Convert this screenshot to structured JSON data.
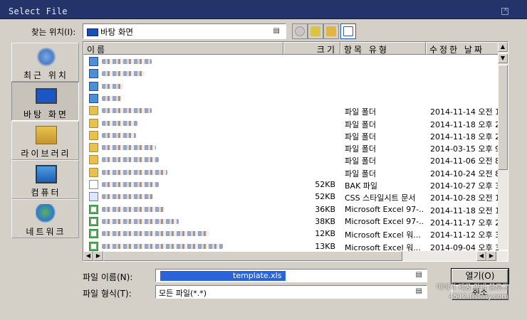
{
  "window": {
    "title": "Select File"
  },
  "lookin": {
    "label": "찾는 위치(I):",
    "value": "바탕 화면"
  },
  "places": [
    {
      "label": "최근 위치",
      "icon": "recent-places-icon"
    },
    {
      "label": "바탕 화면",
      "icon": "desktop-icon",
      "selected": true
    },
    {
      "label": "라이브러리",
      "icon": "libraries-icon"
    },
    {
      "label": "컴퓨터",
      "icon": "computer-icon"
    },
    {
      "label": "네트워크",
      "icon": "network-icon"
    }
  ],
  "columns": {
    "name": "이름",
    "size": "크기",
    "type": "항목 유형",
    "date": "수정한 날짜"
  },
  "rows": [
    {
      "icon": "system",
      "size": "",
      "type": "",
      "date": ""
    },
    {
      "icon": "system",
      "size": "",
      "type": "",
      "date": ""
    },
    {
      "icon": "system",
      "size": "",
      "type": "",
      "date": ""
    },
    {
      "icon": "system",
      "size": "",
      "type": "",
      "date": ""
    },
    {
      "icon": "folder",
      "size": "",
      "type": "파일 폴더",
      "date": "2014-11-14 오전 1"
    },
    {
      "icon": "folder",
      "size": "",
      "type": "파일 폴더",
      "date": "2014-11-18 오후 2"
    },
    {
      "icon": "folder",
      "size": "",
      "type": "파일 폴더",
      "date": "2014-11-18 오후 2"
    },
    {
      "icon": "folder",
      "size": "",
      "type": "파일 폴더",
      "date": "2014-03-15 오후 9"
    },
    {
      "icon": "folder",
      "size": "",
      "type": "파일 폴더",
      "date": "2014-11-06 오전 8"
    },
    {
      "icon": "folder",
      "size": "",
      "type": "파일 폴더",
      "date": "2014-10-24 오전 8"
    },
    {
      "icon": "file",
      "size": "52KB",
      "type": "BAK 파일",
      "date": "2014-10-27 오후 3"
    },
    {
      "icon": "css",
      "size": "52KB",
      "type": "CSS 스타일시트 문서",
      "date": "2014-10-28 오전 1"
    },
    {
      "icon": "xls",
      "size": "36KB",
      "type": "Microsoft Excel 97-...",
      "date": "2014-11-18 오전 1"
    },
    {
      "icon": "xls",
      "size": "38KB",
      "type": "Microsoft Excel 97-...",
      "date": "2014-11-17 오후 2"
    },
    {
      "icon": "xls",
      "size": "12KB",
      "type": "Microsoft Excel 워...",
      "date": "2014-11-12 오후 3"
    },
    {
      "icon": "xls",
      "size": "13KB",
      "type": "Microsoft Excel 워...",
      "date": "2014-09-04 오후 3"
    }
  ],
  "filename": {
    "label": "파일 이름(N):",
    "value": "template.xls"
  },
  "filetype": {
    "label": "파일 형식(T):",
    "value": "모든 파일(*.*)"
  },
  "buttons": {
    "open": "열기(O)",
    "cancel": "취소"
  },
  "watermark": {
    "line1": "이미지 제공 안내 블로그",
    "line2": "4512.tistory.com"
  }
}
